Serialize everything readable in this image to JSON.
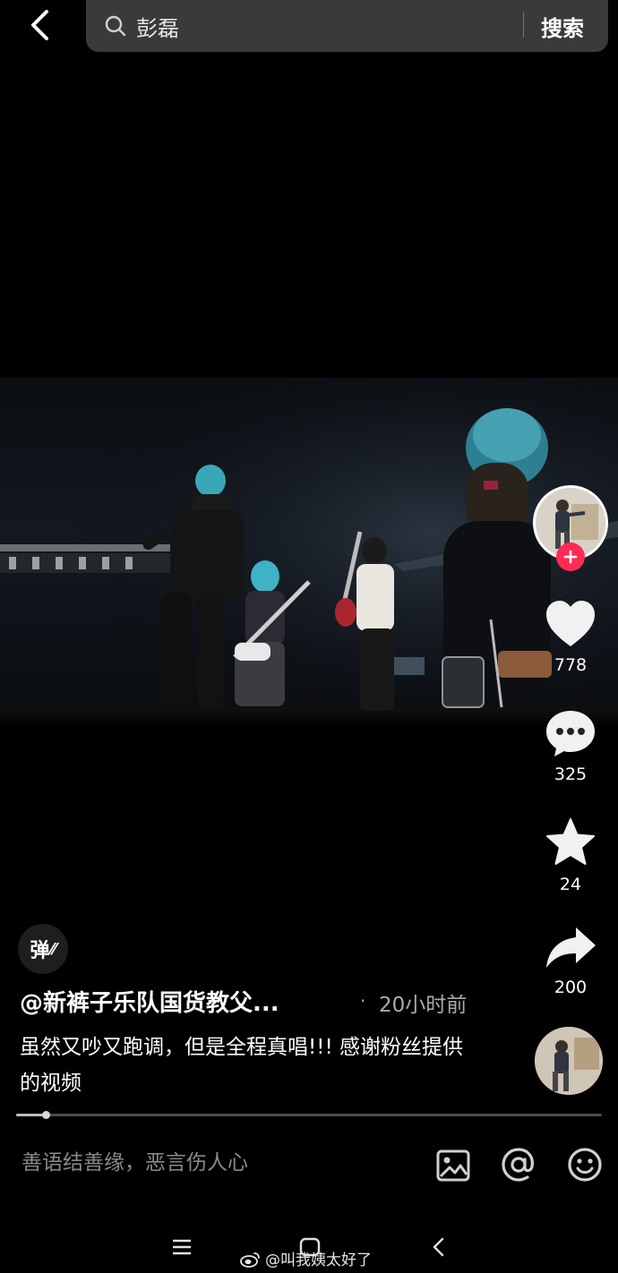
{
  "search": {
    "query": "彭磊",
    "submit_label": "搜索"
  },
  "actions": {
    "like_count": "778",
    "comment_count": "325",
    "favorite_count": "24",
    "share_count": "200"
  },
  "danmu_label": "弹",
  "post": {
    "author": "@新裤子乐队国货教父...",
    "time_separator": "·",
    "time": "20小时前",
    "caption": "虽然又吵又跑调，但是全程真唱!!! 感谢粉丝提供的视频"
  },
  "progress": {
    "fraction": 0.05
  },
  "comment": {
    "placeholder": "善语结善缘，恶言伤人心"
  },
  "watermark": "@叫我姨太好了",
  "colors": {
    "follow_accent": "#fe2c55",
    "search_bg": "#3a3a3a"
  },
  "icons": [
    "back-icon",
    "search-icon",
    "plus-icon",
    "heart-icon",
    "comment-bubble-icon",
    "star-icon",
    "share-arrow-icon",
    "image-icon",
    "at-icon",
    "emoji-icon",
    "menu-icon",
    "home-icon",
    "nav-back-icon",
    "weibo-icon"
  ]
}
